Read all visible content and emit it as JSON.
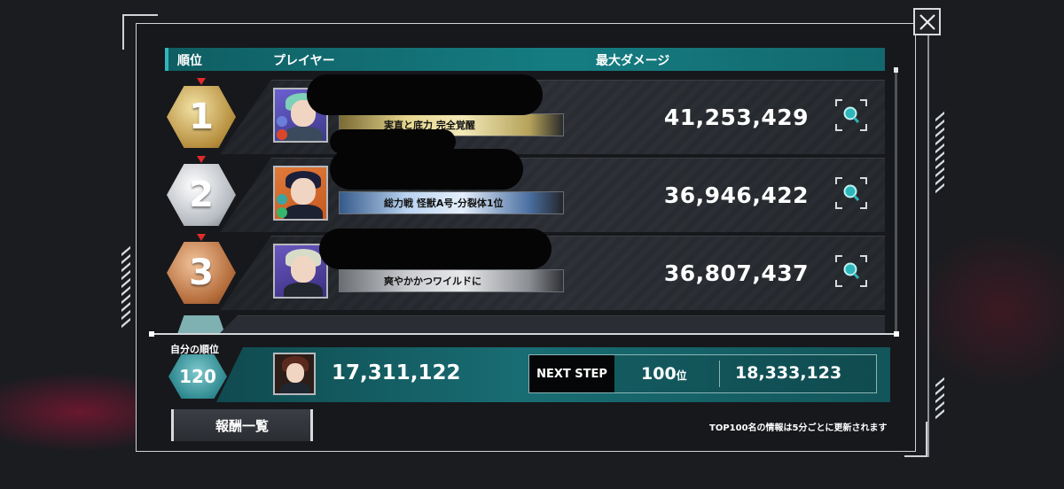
{
  "header": {
    "rank_col": "順位",
    "player_col": "プレイヤー",
    "damage_col": "最大ダメージ"
  },
  "rankings": [
    {
      "rank": "1",
      "title": "実直と底力 完全覚醒",
      "damage": "41,253,429",
      "medal": "gold"
    },
    {
      "rank": "2",
      "title": "総力戦 怪獣A号-分裂体1位",
      "damage": "36,946,422",
      "medal": "silver"
    },
    {
      "rank": "3",
      "title": "爽やかかつワイルドに",
      "damage": "36,807,437",
      "medal": "bronze"
    }
  ],
  "my_rank": {
    "label": "自分の順位",
    "rank": "120",
    "damage": "17,311,122"
  },
  "next_step": {
    "label": "NEXT STEP",
    "rank": "100",
    "rank_unit": "位",
    "score": "18,333,123"
  },
  "footer": {
    "reward_button": "報酬一覧",
    "update_note": "TOP100名の情報は5分ごとに更新されます"
  },
  "icons": {
    "close": "close-icon",
    "zoom": "magnifier-icon"
  },
  "colors": {
    "accent_teal": "#157d82",
    "gold": "#b58d3c",
    "silver": "#b7bcc2",
    "bronze": "#b66e3d",
    "rank_tick": "#e02b2b"
  }
}
